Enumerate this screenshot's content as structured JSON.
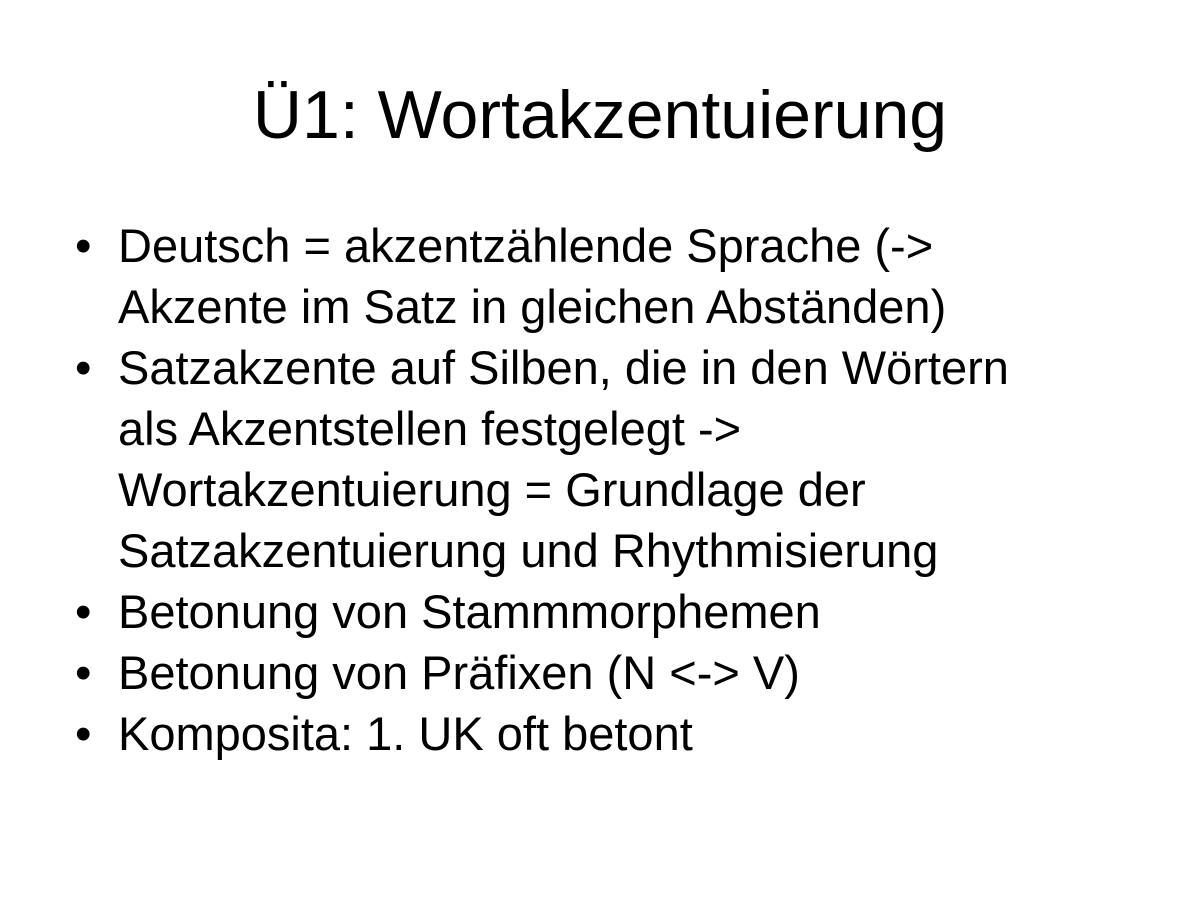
{
  "slide": {
    "title": "Ü1: Wortakzentuierung",
    "bullet_symbol": "•",
    "bullets": [
      {
        "lines": [
          "Deutsch = akzentzählende Sprache (->",
          "Akzente im Satz in gleichen Abständen)"
        ]
      },
      {
        "lines": [
          "Satzakzente auf Silben, die in den Wörtern",
          "als Akzentstellen festgelegt ->",
          "Wortakzentuierung = Grundlage der",
          "Satzakzentuierung und Rhythmisierung"
        ]
      },
      {
        "lines": [
          "Betonung von Stammmorphemen"
        ]
      },
      {
        "lines": [
          "Betonung von Präfixen (N <-> V)"
        ]
      },
      {
        "lines": [
          "Komposita: 1. UK oft betont"
        ]
      }
    ]
  },
  "colors": {
    "background": "#ffffff",
    "text": "#000000"
  }
}
